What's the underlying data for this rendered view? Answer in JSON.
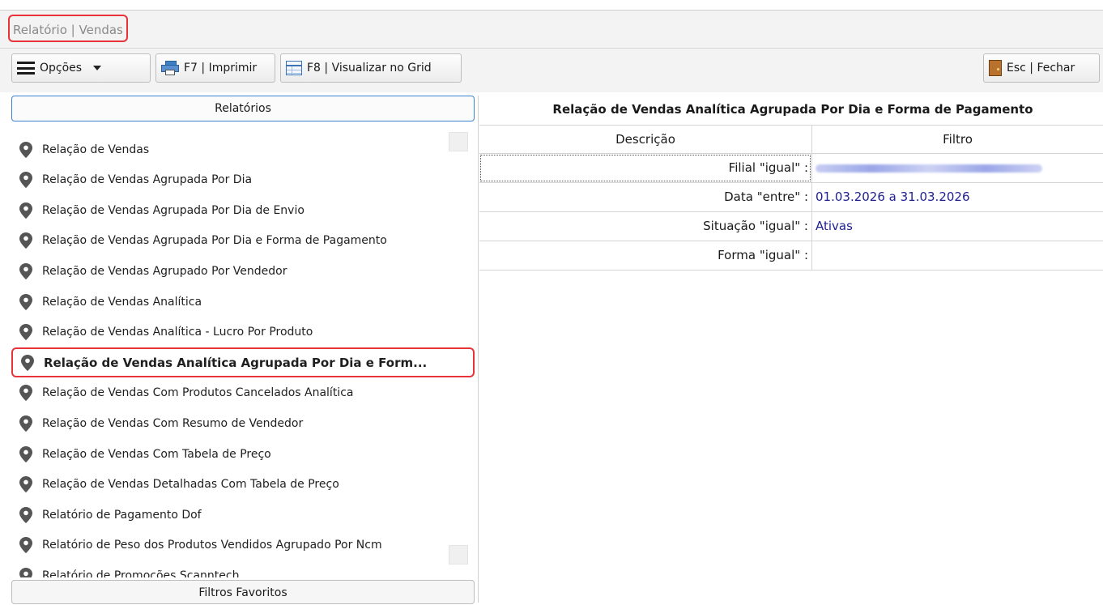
{
  "window": {
    "title": "Relatório | Vendas"
  },
  "toolbar": {
    "options_label": "Opções",
    "print_label": "F7 | Imprimir",
    "grid_label": "F8 | Visualizar no Grid",
    "close_label": "Esc | Fechar"
  },
  "left_panel": {
    "header": "Relatórios",
    "footer": "Filtros Favoritos",
    "items": [
      {
        "label": "Relação de Vendas"
      },
      {
        "label": "Relação de Vendas Agrupada Por Dia"
      },
      {
        "label": "Relação de Vendas Agrupada Por Dia de Envio"
      },
      {
        "label": "Relação de Vendas Agrupada Por Dia e Forma de Pagamento"
      },
      {
        "label": "Relação de Vendas Agrupado Por Vendedor"
      },
      {
        "label": "Relação de Vendas Analítica"
      },
      {
        "label": "Relação de Vendas Analítica - Lucro Por Produto"
      },
      {
        "label": "Relação de Vendas Analítica Agrupada Por Dia e Form...",
        "selected": true
      },
      {
        "label": "Relação de Vendas Com Produtos Cancelados Analítica"
      },
      {
        "label": "Relação de Vendas Com Resumo de Vendedor"
      },
      {
        "label": "Relação de Vendas Com Tabela de Preço"
      },
      {
        "label": "Relação de Vendas Detalhadas Com Tabela de Preço"
      },
      {
        "label": "Relatório de Pagamento Dof"
      },
      {
        "label": "Relatório de Peso dos Produtos Vendidos Agrupado Por Ncm"
      },
      {
        "label": "Relatório de Promoções Scanntech"
      }
    ]
  },
  "right_panel": {
    "title": "Relação de Vendas Analítica Agrupada Por Dia e Forma de Pagamento",
    "columns": [
      "Descrição",
      "Filtro"
    ],
    "rows": [
      {
        "desc": "Filial \"igual\" :",
        "value": ""
      },
      {
        "desc": "Data \"entre\" :",
        "value": "01.03.2026 a 31.03.2026"
      },
      {
        "desc": "Situação \"igual\" :",
        "value": "Ativas"
      },
      {
        "desc": "Forma \"igual\" :",
        "value": ""
      }
    ]
  },
  "colors": {
    "highlight": "#e8333a",
    "accent": "#3b83d1",
    "value_text": "#1f1f8f"
  },
  "icons": [
    "hamburger-icon",
    "chevron-down-icon",
    "printer-icon",
    "grid-icon",
    "door-icon",
    "map-pin-icon"
  ]
}
